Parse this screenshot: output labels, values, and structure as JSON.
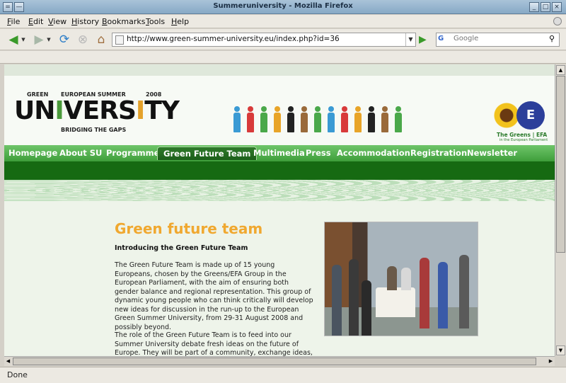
{
  "window": {
    "title": "Summeruniversity - Mozilla Firefox"
  },
  "menu": [
    {
      "label": "File",
      "key": "F",
      "rest": "ile"
    },
    {
      "label": "Edit",
      "key": "E",
      "rest": "dit"
    },
    {
      "label": "View",
      "key": "V",
      "rest": "iew"
    },
    {
      "label": "History",
      "key": "H",
      "rest": "istory"
    },
    {
      "label": "Bookmarks",
      "key": "B",
      "rest": "ookmarks"
    },
    {
      "label": "Tools",
      "key": "T",
      "rest": "ools"
    },
    {
      "label": "Help",
      "key": "H",
      "rest": "elp"
    }
  ],
  "navbar": {
    "url": "http://www.green-summer-university.eu/index.php?id=36",
    "search_engine": "G",
    "search_placeholder": "Google"
  },
  "status": {
    "text": "Done"
  },
  "site": {
    "logo": {
      "green": "GREEN",
      "european_summer": "EUROPEAN SUMMER",
      "year": "2008",
      "main_pre": "UN",
      "main_i": "I",
      "main_mid": "VERS",
      "main_i2": "I",
      "main_end": "TY",
      "sub": "BRIDGING THE GAPS"
    },
    "party": {
      "name": "The Greens | EFA",
      "sub": "in the European Parliament",
      "emblem": "E"
    },
    "nav": [
      "Homepage",
      "About SU",
      "Programme",
      "Green Future Team",
      "Multimedia",
      "Press",
      "Accommodation",
      "Registration",
      "Newsletter"
    ],
    "nav_active": "Green Future Team",
    "people_colors": [
      "#3a9ad4",
      "#d83a3a",
      "#4aa84a",
      "#e8a428",
      "#222222",
      "#9a6a3a",
      "#4aa84a",
      "#3a9ad4",
      "#d83a3a",
      "#e8a428",
      "#222222",
      "#9a6a3a",
      "#4aa84a"
    ]
  },
  "content": {
    "title": "Green future team",
    "section_head": "Introducing the Green Future Team",
    "para1": "The Green Future Team is made up of 15 young Europeans, chosen by the Greens/EFA Group in the European Parliament, with the aim of ensuring both gender balance and regional representation. This group of dynamic young people who can think critically will develop new ideas for discussion in the run-up to the European Green Summer University, from 29-31 August 2008 and possibly beyond.",
    "para2": "The role of the Green Future Team is to feed into our Summer University debate fresh ideas on the future of Europe. They will be part of a community, exchange ideas, meet on several occasions"
  }
}
